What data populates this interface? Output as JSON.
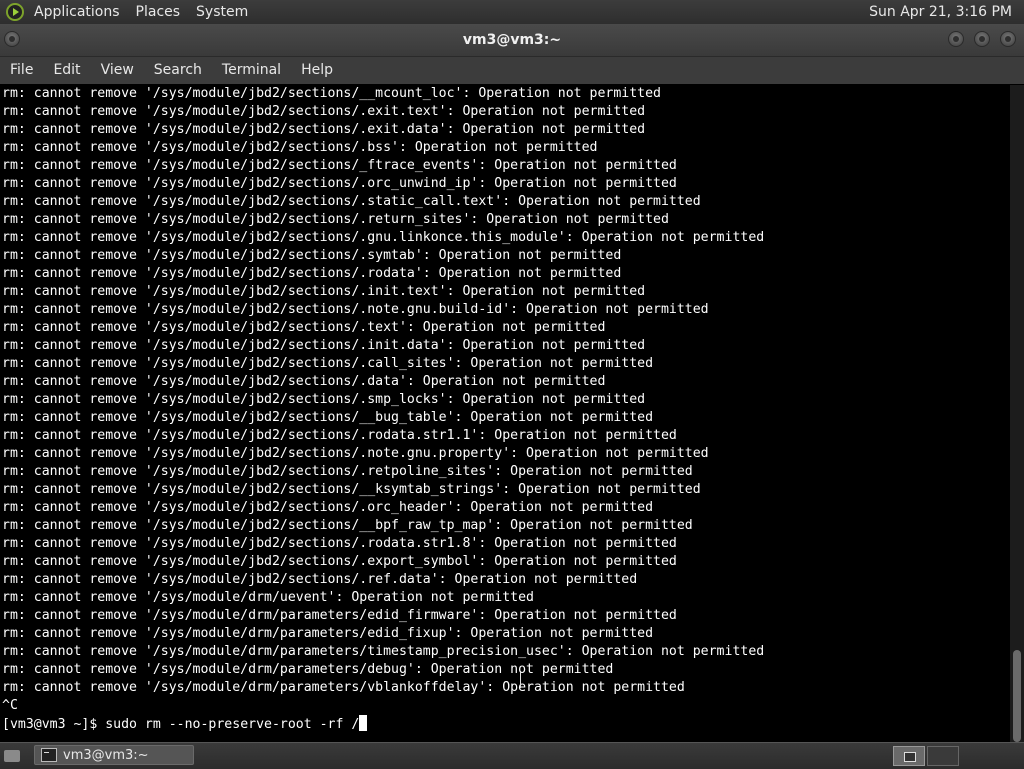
{
  "top_panel": {
    "menus": [
      "Applications",
      "Places",
      "System"
    ],
    "clock": "Sun Apr 21,  3:16 PM"
  },
  "window": {
    "title": "vm3@vm3:~"
  },
  "menubar": [
    "File",
    "Edit",
    "View",
    "Search",
    "Terminal",
    "Help"
  ],
  "terminal": {
    "lines": [
      "rm: cannot remove '/sys/module/jbd2/sections/__mcount_loc': Operation not permitted",
      "rm: cannot remove '/sys/module/jbd2/sections/.exit.text': Operation not permitted",
      "rm: cannot remove '/sys/module/jbd2/sections/.exit.data': Operation not permitted",
      "rm: cannot remove '/sys/module/jbd2/sections/.bss': Operation not permitted",
      "rm: cannot remove '/sys/module/jbd2/sections/_ftrace_events': Operation not permitted",
      "rm: cannot remove '/sys/module/jbd2/sections/.orc_unwind_ip': Operation not permitted",
      "rm: cannot remove '/sys/module/jbd2/sections/.static_call.text': Operation not permitted",
      "rm: cannot remove '/sys/module/jbd2/sections/.return_sites': Operation not permitted",
      "rm: cannot remove '/sys/module/jbd2/sections/.gnu.linkonce.this_module': Operation not permitted",
      "rm: cannot remove '/sys/module/jbd2/sections/.symtab': Operation not permitted",
      "rm: cannot remove '/sys/module/jbd2/sections/.rodata': Operation not permitted",
      "rm: cannot remove '/sys/module/jbd2/sections/.init.text': Operation not permitted",
      "rm: cannot remove '/sys/module/jbd2/sections/.note.gnu.build-id': Operation not permitted",
      "rm: cannot remove '/sys/module/jbd2/sections/.text': Operation not permitted",
      "rm: cannot remove '/sys/module/jbd2/sections/.init.data': Operation not permitted",
      "rm: cannot remove '/sys/module/jbd2/sections/.call_sites': Operation not permitted",
      "rm: cannot remove '/sys/module/jbd2/sections/.data': Operation not permitted",
      "rm: cannot remove '/sys/module/jbd2/sections/.smp_locks': Operation not permitted",
      "rm: cannot remove '/sys/module/jbd2/sections/__bug_table': Operation not permitted",
      "rm: cannot remove '/sys/module/jbd2/sections/.rodata.str1.1': Operation not permitted",
      "rm: cannot remove '/sys/module/jbd2/sections/.note.gnu.property': Operation not permitted",
      "rm: cannot remove '/sys/module/jbd2/sections/.retpoline_sites': Operation not permitted",
      "rm: cannot remove '/sys/module/jbd2/sections/__ksymtab_strings': Operation not permitted",
      "rm: cannot remove '/sys/module/jbd2/sections/.orc_header': Operation not permitted",
      "rm: cannot remove '/sys/module/jbd2/sections/__bpf_raw_tp_map': Operation not permitted",
      "rm: cannot remove '/sys/module/jbd2/sections/.rodata.str1.8': Operation not permitted",
      "rm: cannot remove '/sys/module/jbd2/sections/.export_symbol': Operation not permitted",
      "rm: cannot remove '/sys/module/jbd2/sections/.ref.data': Operation not permitted",
      "rm: cannot remove '/sys/module/drm/uevent': Operation not permitted",
      "rm: cannot remove '/sys/module/drm/parameters/edid_firmware': Operation not permitted",
      "rm: cannot remove '/sys/module/drm/parameters/edid_fixup': Operation not permitted",
      "rm: cannot remove '/sys/module/drm/parameters/timestamp_precision_usec': Operation not permitted",
      "rm: cannot remove '/sys/module/drm/parameters/debug': Operation not permitted",
      "rm: cannot remove '/sys/module/drm/parameters/vblankoffdelay': Operation not permitted",
      "^C"
    ],
    "prompt": "[vm3@vm3 ~]$ ",
    "command": "sudo rm --no-preserve-root -rf /"
  },
  "scrollbar": {
    "thumb_start_fraction": 0.86,
    "thumb_length_fraction": 0.14
  },
  "taskbar": {
    "task_label": "vm3@vm3:~"
  },
  "icons": {
    "panel_logo": "gnome-foot-icon",
    "task_item": "terminal-icon",
    "show_desktop": "show-desktop-icon",
    "workspace": "workspace-switcher-icon"
  }
}
